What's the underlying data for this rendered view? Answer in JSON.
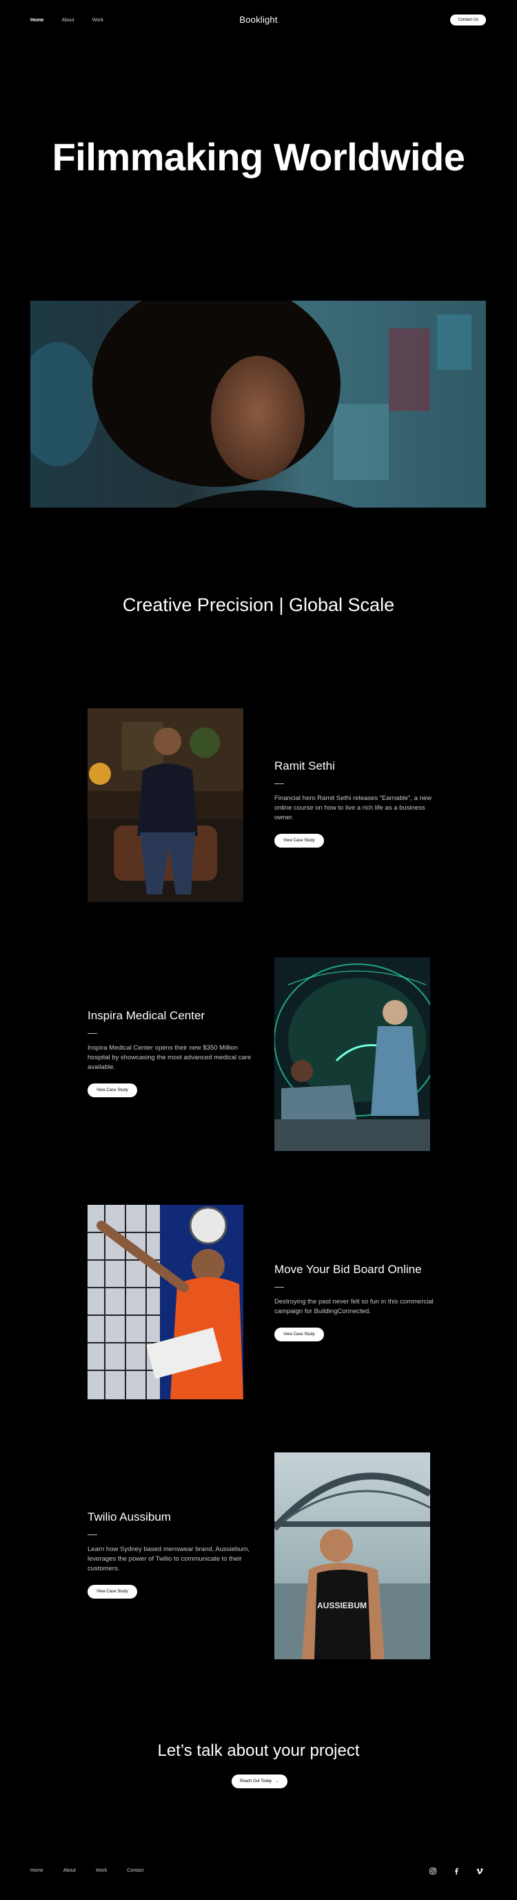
{
  "header": {
    "nav": [
      "Home",
      "About",
      "Work"
    ],
    "logo": "Booklight",
    "contact_label": "Contact Us"
  },
  "hero": {
    "title": "Filmmaking Worldwide",
    "tagline": "Creative Precision | Global Scale"
  },
  "cases": [
    {
      "title": "Ramit Sethi",
      "description": "Financial hero Ramit Sethi releases \"Earnable\", a new online course on how to live a rich life as a business owner.",
      "button": "View Case Study"
    },
    {
      "title": "Inspira Medical Center",
      "description": "Inspira Medical Center opens their new $350 Million hospital by showcasing the most advanced medical care available.",
      "button": "View Case Study"
    },
    {
      "title": "Move Your Bid Board Online",
      "description": "Destroying the past never felt so fun in this commercial campaign for BuildingConnected.",
      "button": "View Case Study"
    },
    {
      "title": "Twilio Aussibum",
      "description": "Learn how Sydney based menswear brand, Aussiebum, leverages the power of Twilio to communicate to their customers.",
      "button": "View Case Study",
      "shirt_text": "AUSSIEBUM"
    }
  ],
  "cta": {
    "title": "Let’s talk about your project",
    "button": "Reach Out Today",
    "button_icon": "→"
  },
  "footer": {
    "nav": [
      "Home",
      "About",
      "Work",
      "Contact"
    ],
    "socials": [
      "instagram-icon",
      "facebook-icon",
      "vimeo-icon"
    ]
  }
}
